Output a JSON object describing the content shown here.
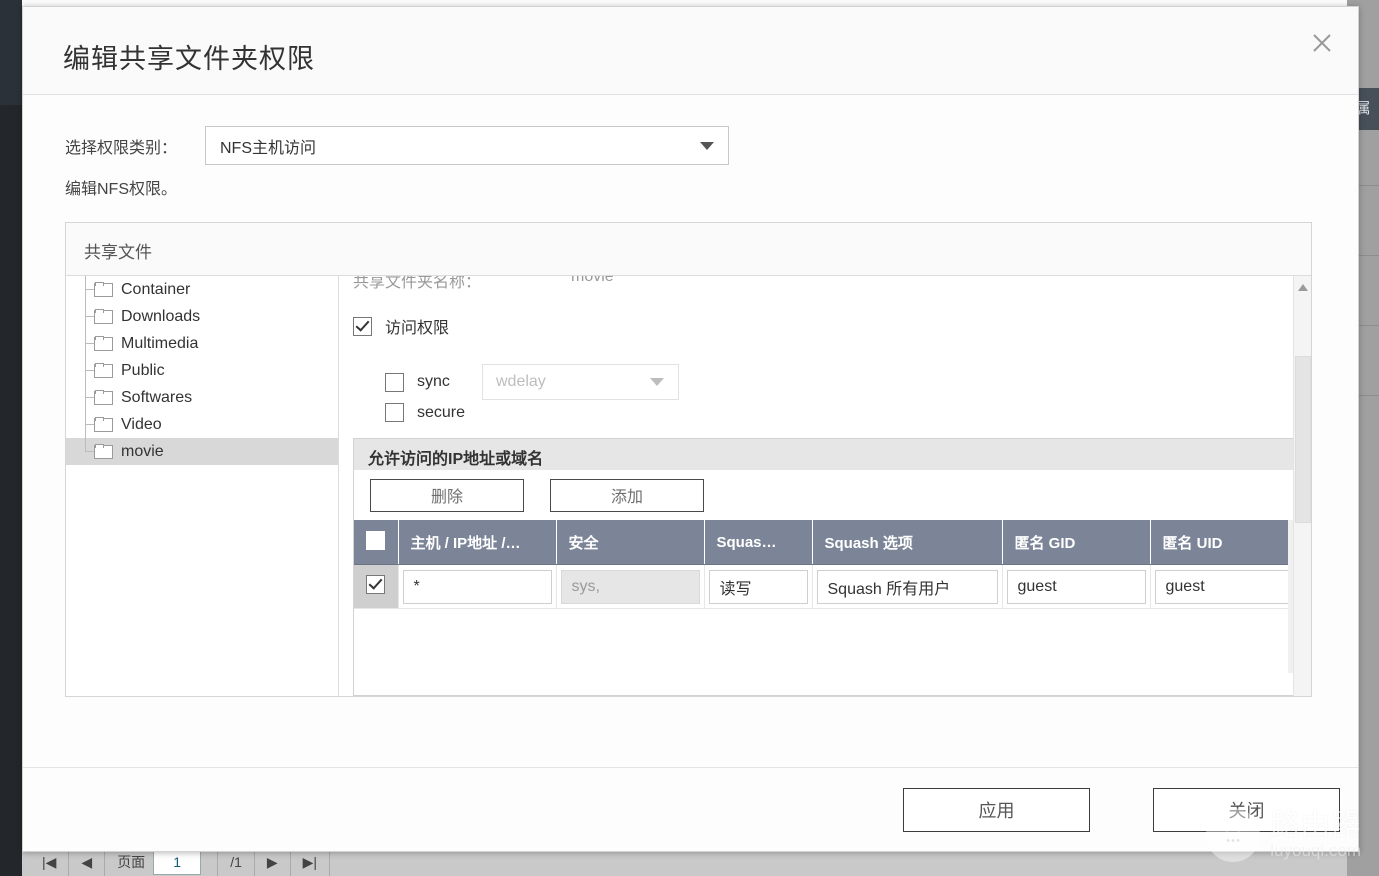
{
  "background": {
    "right_header_char": "属",
    "pager": {
      "first": "|◀",
      "prev": "◀",
      "page_label": "页面",
      "page_value": "1",
      "total": "/1",
      "next": "▶",
      "last": "▶|"
    }
  },
  "modal": {
    "title": "编辑共享文件夹权限",
    "close_icon": "close-icon",
    "permission_type": {
      "label": "选择权限类别：",
      "value": "NFS主机访问"
    },
    "hint": "编辑NFS权限。",
    "panel": {
      "header": "共享文件",
      "tree": {
        "items": [
          {
            "label": "Container",
            "selected": false
          },
          {
            "label": "Downloads",
            "selected": false
          },
          {
            "label": "Multimedia",
            "selected": false
          },
          {
            "label": "Public",
            "selected": false
          },
          {
            "label": "Softwares",
            "selected": false
          },
          {
            "label": "Video",
            "selected": false
          },
          {
            "label": "movie",
            "selected": true
          }
        ]
      },
      "detail": {
        "folder_name_label": "共享文件夹名称：",
        "folder_name_value": "movie",
        "access_permission": {
          "label": "访问权限",
          "checked": true
        },
        "sync": {
          "label": "sync",
          "checked": false,
          "dropdown_value": "wdelay"
        },
        "secure": {
          "label": "secure",
          "checked": false
        },
        "ip_section": {
          "title": "允许访问的IP地址或域名",
          "buttons": {
            "delete": "删除",
            "add": "添加"
          },
          "table": {
            "headers": [
              "",
              "主机 / IP地址 /…",
              "安全",
              "Squas…",
              "Squash 选项",
              "匿名 GID",
              "匿名 UID"
            ],
            "rows": [
              {
                "checked": true,
                "host": "*",
                "security": "sys,",
                "squash_perm": "读写",
                "squash_option": "Squash 所有用户",
                "anon_gid": "guest",
                "anon_uid": "guest"
              }
            ]
          }
        }
      }
    },
    "footer": {
      "apply": "应用",
      "close": "关闭"
    }
  },
  "watermark": {
    "cn": "路由器",
    "en": "luyouqi.com"
  },
  "colors": {
    "table_header": "#7c8597",
    "selected_row": "#d8d8d8",
    "section_title_bg": "#e6e6e6"
  }
}
